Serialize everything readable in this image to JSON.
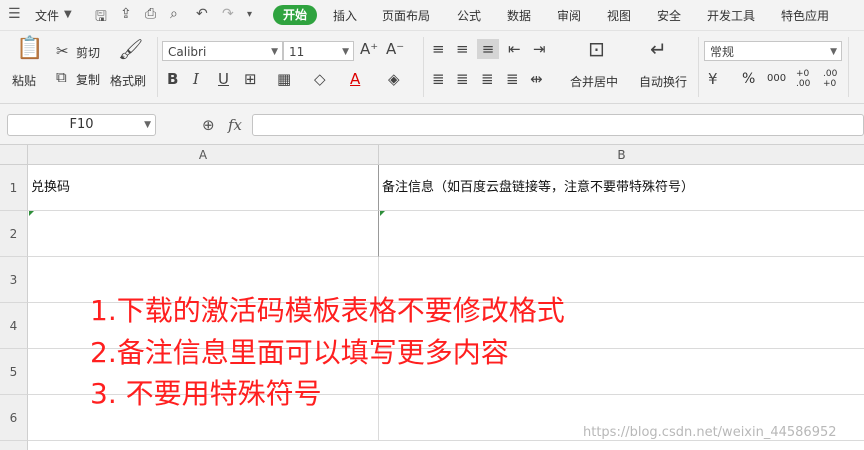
{
  "menubar": {
    "file": "文件",
    "start": "开始",
    "tabs": [
      "插入",
      "页面布局",
      "公式",
      "数据",
      "审阅",
      "视图",
      "安全",
      "开发工具",
      "特色应用"
    ]
  },
  "ribbon": {
    "paste": "粘贴",
    "cut": "剪切",
    "copy": "复制",
    "format_painter": "格式刷",
    "font_name": "Calibri",
    "font_size": "11",
    "merge_center": "合并居中",
    "wrap_text": "自动换行",
    "number_format": "常规",
    "percent": "%",
    "thousands": "000",
    "inc_decimal": "+0 .00",
    "dec_decimal": ".00 +0"
  },
  "formula_bar": {
    "name_box": "F10",
    "fx": "fx",
    "value": ""
  },
  "sheet": {
    "columns": [
      "A",
      "B"
    ],
    "rows": [
      "1",
      "2",
      "3",
      "4",
      "5",
      "6"
    ],
    "cells": {
      "A1": "兑换码",
      "B1": "备注信息（如百度云盘链接等，注意不要带特殊符号）"
    }
  },
  "annotation": {
    "line1": "1.下载的激活码模板表格不要修改格式",
    "line2": "2.备注信息里面可以填写更多内容",
    "line3": "3. 不要用特殊符号"
  },
  "watermark": "https://blog.csdn.net/weixin_44586952",
  "colors": {
    "accent_green": "#2fa33f",
    "annotation_red": "#ff1f1f"
  }
}
